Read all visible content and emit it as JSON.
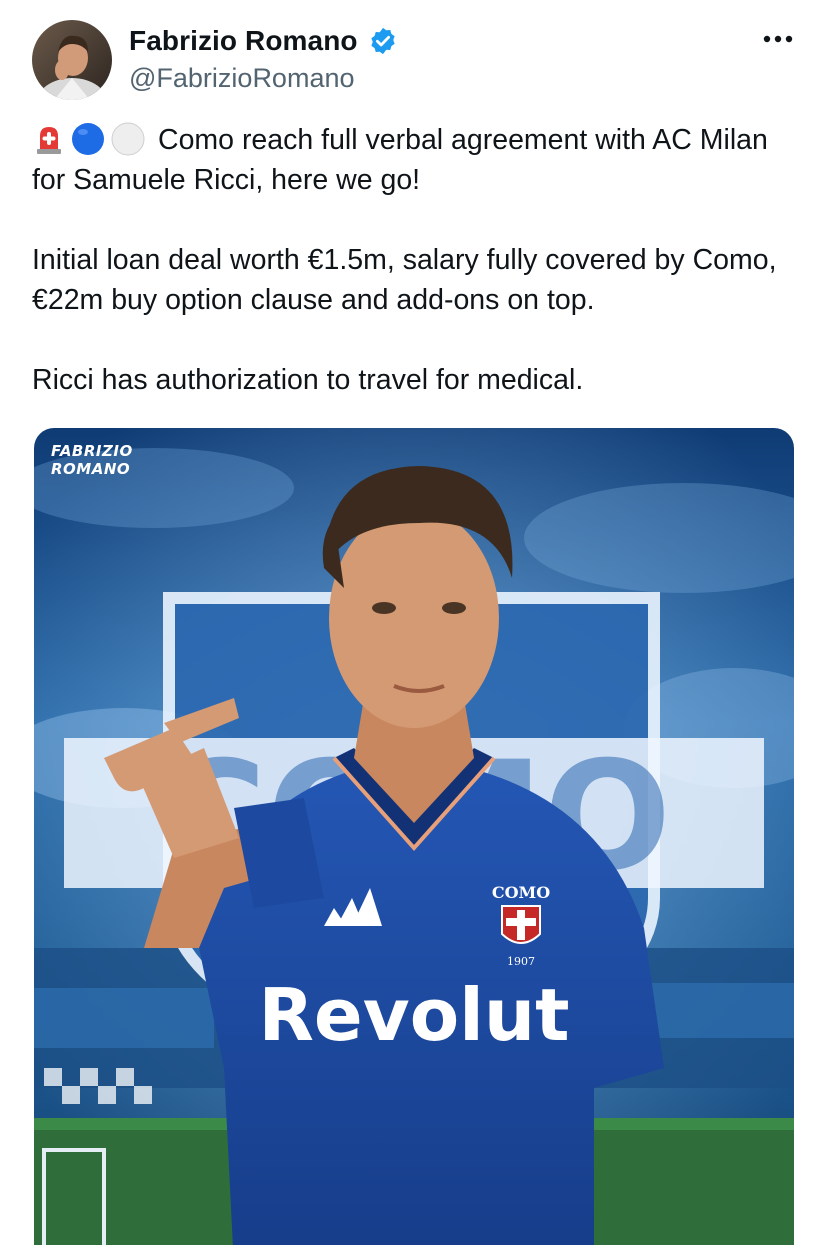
{
  "author": {
    "display_name": "Fabrizio Romano",
    "handle": "@FabrizioRomano",
    "verified": true,
    "verified_color": "#1d9bf0"
  },
  "tweet": {
    "emojis": [
      "rotating-light-icon",
      "blue-circle-icon",
      "white-circle-icon"
    ],
    "line1": "Como reach full verbal agreement with AC Milan for Samuele Ricci, here we go!",
    "line2": "Initial loan deal worth €1.5m, salary fully covered by Como, €22m buy option clause and add-ons on top.",
    "line3": "Ricci has authorization to travel for medical."
  },
  "media": {
    "watermark_line1": "FABRIZIO",
    "watermark_line2": "ROMANO",
    "sponsor_text": "Revolut",
    "crest_text": "COMO",
    "crest_year": "1907",
    "accent_color": "#1f4fa8"
  }
}
